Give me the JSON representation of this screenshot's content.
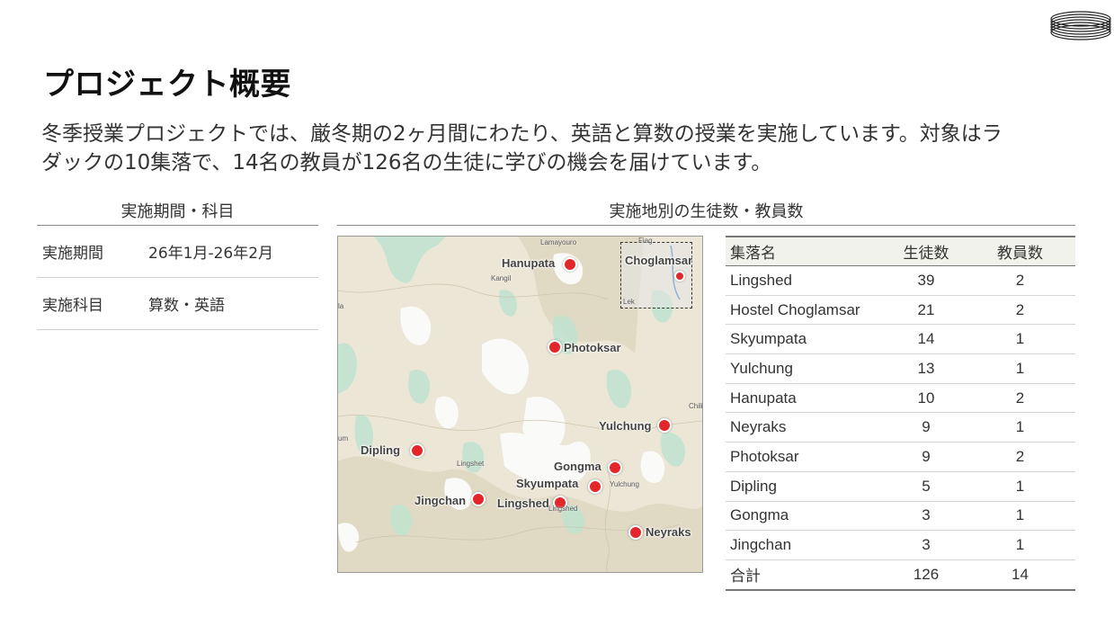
{
  "page": {
    "title": "プロジェクト概要",
    "intro_line1": "冬季授業プロジェクトでは、厳冬期の2ヶ月間にわたり、英語と算数の授業を実施しています。対象はラ",
    "intro_line2": "ダックの10集落で、14名の教員が126名の生徒に学びの機会を届けています。"
  },
  "left_panel": {
    "heading": "実施期間・科目",
    "rows": [
      {
        "label": "実施期間",
        "value": "26年1月-26年2月"
      },
      {
        "label": "実施科目",
        "value": "算数・英語"
      }
    ]
  },
  "right_panel": {
    "heading": "実施地別の生徒数・教員数"
  },
  "map": {
    "inset_label": "Choglamsar",
    "markers": [
      "Hanupata",
      "Photoksar",
      "Yulchung",
      "Dipling",
      "Gongma",
      "Skyumpata",
      "Jingchan",
      "Lingshed",
      "Neyraks"
    ],
    "background_labels": [
      "Lamayouro",
      "Kangil",
      "Lingshet",
      "Yulchung",
      "Lingshed",
      "Chili",
      "la",
      "um",
      "Fiag",
      "Lek"
    ]
  },
  "table": {
    "headers": [
      "集落名",
      "生徒数",
      "教員数"
    ],
    "rows": [
      {
        "name": "Lingshed",
        "students": "39",
        "teachers": "2"
      },
      {
        "name": "Hostel Choglamsar",
        "students": "21",
        "teachers": "2"
      },
      {
        "name": "Skyumpata",
        "students": "14",
        "teachers": "1"
      },
      {
        "name": "Yulchung",
        "students": "13",
        "teachers": "1"
      },
      {
        "name": "Hanupata",
        "students": "10",
        "teachers": "2"
      },
      {
        "name": "Neyraks",
        "students": "9",
        "teachers": "1"
      },
      {
        "name": "Photoksar",
        "students": "9",
        "teachers": "2"
      },
      {
        "name": "Dipling",
        "students": "5",
        "teachers": "1"
      },
      {
        "name": "Gongma",
        "students": "3",
        "teachers": "1"
      },
      {
        "name": "Jingchan",
        "students": "3",
        "teachers": "1"
      }
    ],
    "total": {
      "name": "合計",
      "students": "126",
      "teachers": "14"
    }
  },
  "colors": {
    "marker": "#e3262a",
    "terrain_base": "#ebe6d6",
    "snow": "#fafaf8",
    "vegetation": "#bfe3cf"
  },
  "icons": {
    "logo": "concentric-rings-logo"
  }
}
